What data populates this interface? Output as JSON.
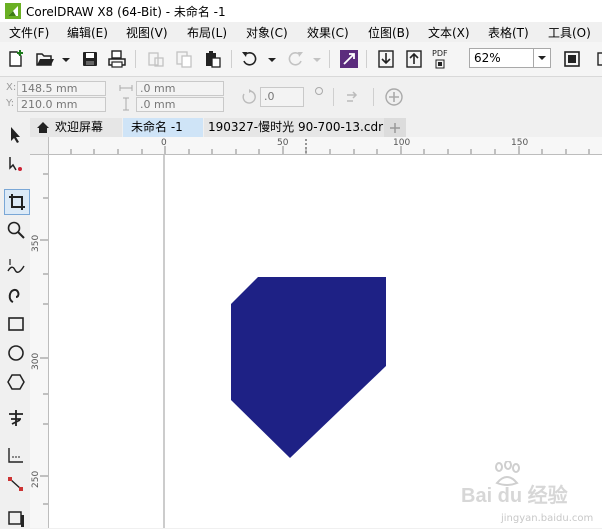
{
  "window": {
    "title": "CorelDRAW X8 (64-Bit) - 未命名 -1"
  },
  "menu": [
    "文件(F)",
    "编辑(E)",
    "视图(V)",
    "布局(L)",
    "对象(C)",
    "效果(C)",
    "位图(B)",
    "文本(X)",
    "表格(T)",
    "工具(O)"
  ],
  "toolbar": {
    "pdf_label": "PDF",
    "zoom_value": "62%"
  },
  "property_bar": {
    "x_label": "X:",
    "x_value": "148.5 mm",
    "y_label": "Y:",
    "y_value": "210.0 mm",
    "width_value": ".0 mm",
    "height_value": ".0 mm",
    "rotation_value": ".0"
  },
  "tabs": [
    {
      "label": "欢迎屏幕",
      "active": false
    },
    {
      "label": "未命名 -1",
      "active": true
    },
    {
      "label": "190327-慢时光 90-700-13.cdr",
      "active": false
    }
  ],
  "rulers": {
    "horizontal_labels": [
      "0",
      "50",
      "100",
      "150"
    ],
    "vertical_labels": [
      "350",
      "300",
      "250"
    ]
  },
  "watermark": {
    "logo_text": "Bai du 经验",
    "url": "jingyan.baidu.com"
  },
  "colors": {
    "shape_fill": "#1e2185",
    "accent": "#2b7fd0",
    "active_tab": "#cfe4f7",
    "logo_green": "#6ab023"
  }
}
